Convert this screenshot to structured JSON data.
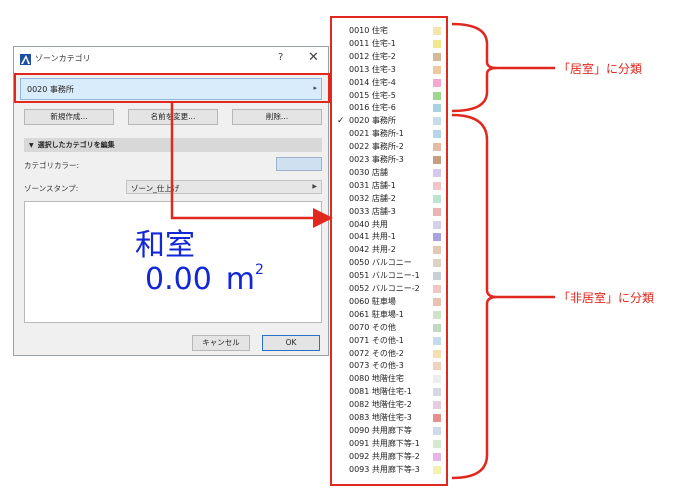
{
  "dialog": {
    "title": "ゾーンカテゴリ",
    "help_label": "?",
    "close_label": "✕",
    "selected_category": "0020 事務所",
    "buttons": {
      "new": "新規作成...",
      "rename": "名前を変更...",
      "delete": "削除..."
    },
    "section_title": "選択したカテゴリを編集",
    "category_color_label": "カテゴリカラー:",
    "category_color": "#cfe0f1",
    "zone_stamp_label": "ゾーンスタンプ:",
    "zone_stamp_value": "ゾーン_仕上げ",
    "preview": {
      "name": "和室",
      "area_value": "0.00",
      "area_unit": "m",
      "area_exp": "2"
    },
    "cancel_label": "キャンセル",
    "ok_label": "OK"
  },
  "dropdown": {
    "selected_index": 7,
    "items": [
      {
        "label": "0010 住宅",
        "color": "#f2e6a6"
      },
      {
        "label": "0011 住宅-1",
        "color": "#f3e78e"
      },
      {
        "label": "0012 住宅-2",
        "color": "#d6b89a"
      },
      {
        "label": "0013 住宅-3",
        "color": "#f0c8a0"
      },
      {
        "label": "0014 住宅-4",
        "color": "#f4a7d0"
      },
      {
        "label": "0015 住宅-5",
        "color": "#9fd68e"
      },
      {
        "label": "0016 住宅-6",
        "color": "#a8d3de"
      },
      {
        "label": "0020 事務所",
        "color": "#c9dcec"
      },
      {
        "label": "0021 事務所-1",
        "color": "#b7d5ea"
      },
      {
        "label": "0022 事務所-2",
        "color": "#e3bca6"
      },
      {
        "label": "0023 事務所-3",
        "color": "#c89c82"
      },
      {
        "label": "0030 店舗",
        "color": "#d6c9ea"
      },
      {
        "label": "0031 店舗-1",
        "color": "#f2c3c8"
      },
      {
        "label": "0032 店舗-2",
        "color": "#bde3d3"
      },
      {
        "label": "0033 店舗-3",
        "color": "#eab4b4"
      },
      {
        "label": "0040 共用",
        "color": "#d6d0ea"
      },
      {
        "label": "0041 共用-1",
        "color": "#a9a2df"
      },
      {
        "label": "0042 共用-2",
        "color": "#e3c9b3"
      },
      {
        "label": "0050 バルコニー",
        "color": "#ddd2c3"
      },
      {
        "label": "0051 バルコニー-1",
        "color": "#c9cfd6"
      },
      {
        "label": "0052 バルコニー-2",
        "color": "#f0c7c7"
      },
      {
        "label": "0060 駐車場",
        "color": "#e8c2b2"
      },
      {
        "label": "0061 駐車場-1",
        "color": "#cfe3c6"
      },
      {
        "label": "0070 その他",
        "color": "#bfd9c2"
      },
      {
        "label": "0071 その他-1",
        "color": "#c4dbeb"
      },
      {
        "label": "0072 その他-2",
        "color": "#f3dfb0"
      },
      {
        "label": "0073 その他-3",
        "color": "#f2d0c0"
      },
      {
        "label": "0080 地階住宅",
        "color": "#ededed"
      },
      {
        "label": "0081 地階住宅-1",
        "color": "#d7d7e6"
      },
      {
        "label": "0082 地階住宅-2",
        "color": "#e7cde0"
      },
      {
        "label": "0083 地階住宅-3",
        "color": "#e68f8f"
      },
      {
        "label": "0090 共用廊下等",
        "color": "#cfdaea"
      },
      {
        "label": "0091 共用廊下等-1",
        "color": "#d5e8d0"
      },
      {
        "label": "0092 共用廊下等-2",
        "color": "#e6b6e6"
      },
      {
        "label": "0093 共用廊下等-3",
        "color": "#f2f2b0"
      }
    ]
  },
  "annotations": {
    "habitable": "「居室」に分類",
    "non_habitable": "「非居室」に分類"
  },
  "colors": {
    "highlight_red": "#e0281f",
    "preview_blue": "#1327d6",
    "selection_blue": "#d9ecfb"
  }
}
